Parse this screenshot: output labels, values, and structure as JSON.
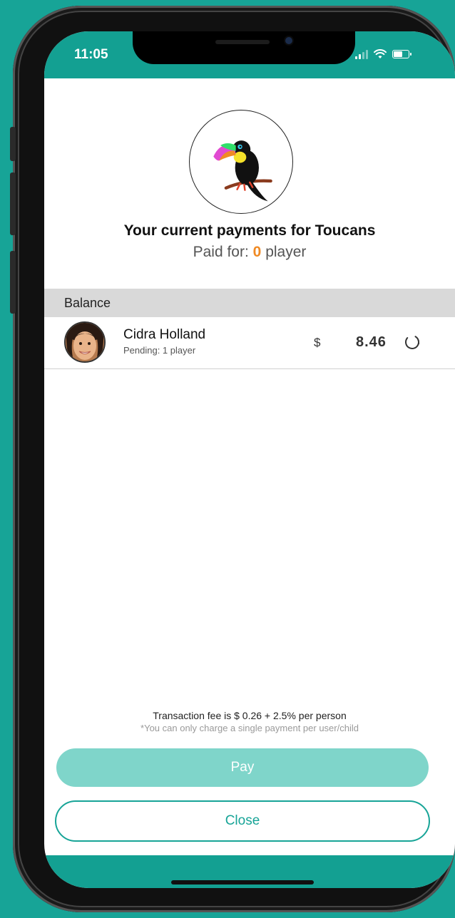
{
  "status_bar": {
    "time": "11:05"
  },
  "header": {
    "headline": "Your current payments for Toucans",
    "paid_for_label": "Paid for:",
    "paid_for_count": "0",
    "paid_for_unit": "player"
  },
  "balance": {
    "section_title": "Balance",
    "rows": [
      {
        "name": "Cidra Holland",
        "status": "Pending: 1 player",
        "currency": "$",
        "amount": "8.46"
      }
    ]
  },
  "footer": {
    "fee_text": "Transaction fee is $ 0.26 + 2.5% per person",
    "fee_note": "*You can only charge a single payment per user/child"
  },
  "actions": {
    "pay_label": "Pay",
    "close_label": "Close"
  },
  "colors": {
    "accent": "#17a497",
    "pay_button": "#7fd5ca",
    "highlight_count": "#f08a24",
    "section_header_bg": "#d9d9d9"
  }
}
